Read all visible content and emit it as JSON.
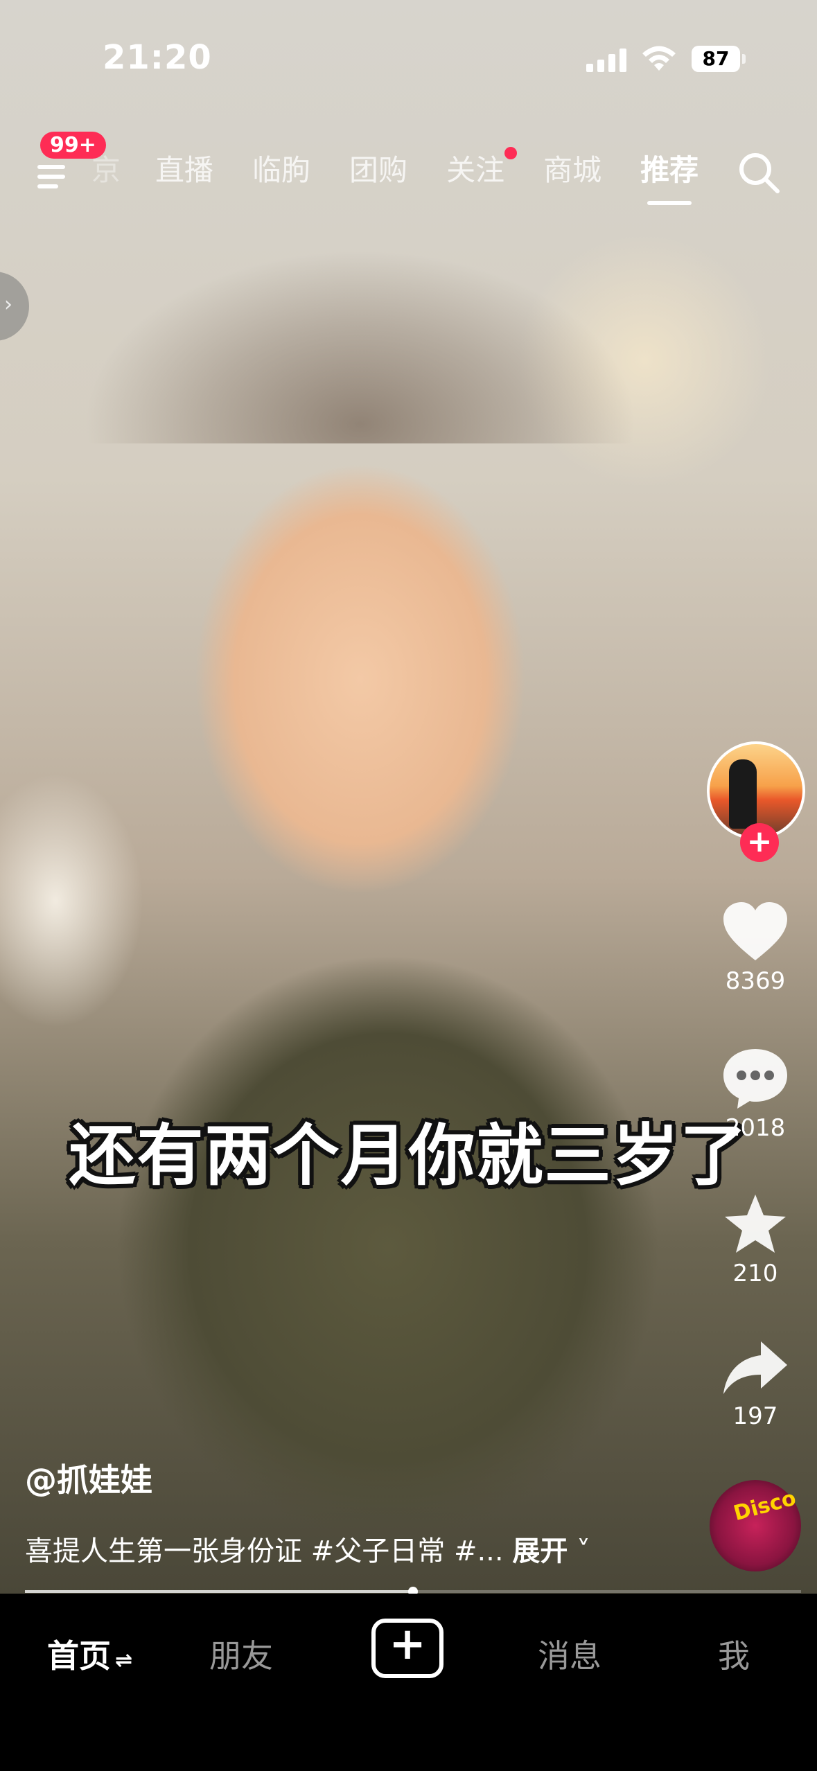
{
  "status_bar": {
    "time": "21:20",
    "battery": "87"
  },
  "topnav": {
    "menu_badge": "99+",
    "tabs": [
      "京",
      "直播",
      "临朐",
      "团购",
      "关注",
      "商城",
      "推荐"
    ],
    "active_tab": "推荐"
  },
  "video": {
    "subtitle": "还有两个月你就三岁了",
    "author": "@抓娃娃",
    "caption": "喜提人生第一张身份证 #父子日常 #...",
    "expand_label": "展开",
    "progress": 0.5
  },
  "actions": {
    "likes": "8369",
    "comments": "2018",
    "favorites": "210",
    "shares": "197"
  },
  "music_disc": {
    "label": "Disco"
  },
  "bottom_nav": {
    "home": "首页",
    "friends": "朋友",
    "messages": "消息",
    "me": "我"
  },
  "colors": {
    "accent": "#fe2c55",
    "background": "#000000"
  },
  "icons": [
    "menu-icon",
    "search-icon",
    "heart-icon",
    "comment-icon",
    "star-icon",
    "share-icon",
    "plus-icon",
    "chevron-right-icon",
    "chevron-down-icon",
    "wifi-icon",
    "signal-icon",
    "battery-icon"
  ]
}
